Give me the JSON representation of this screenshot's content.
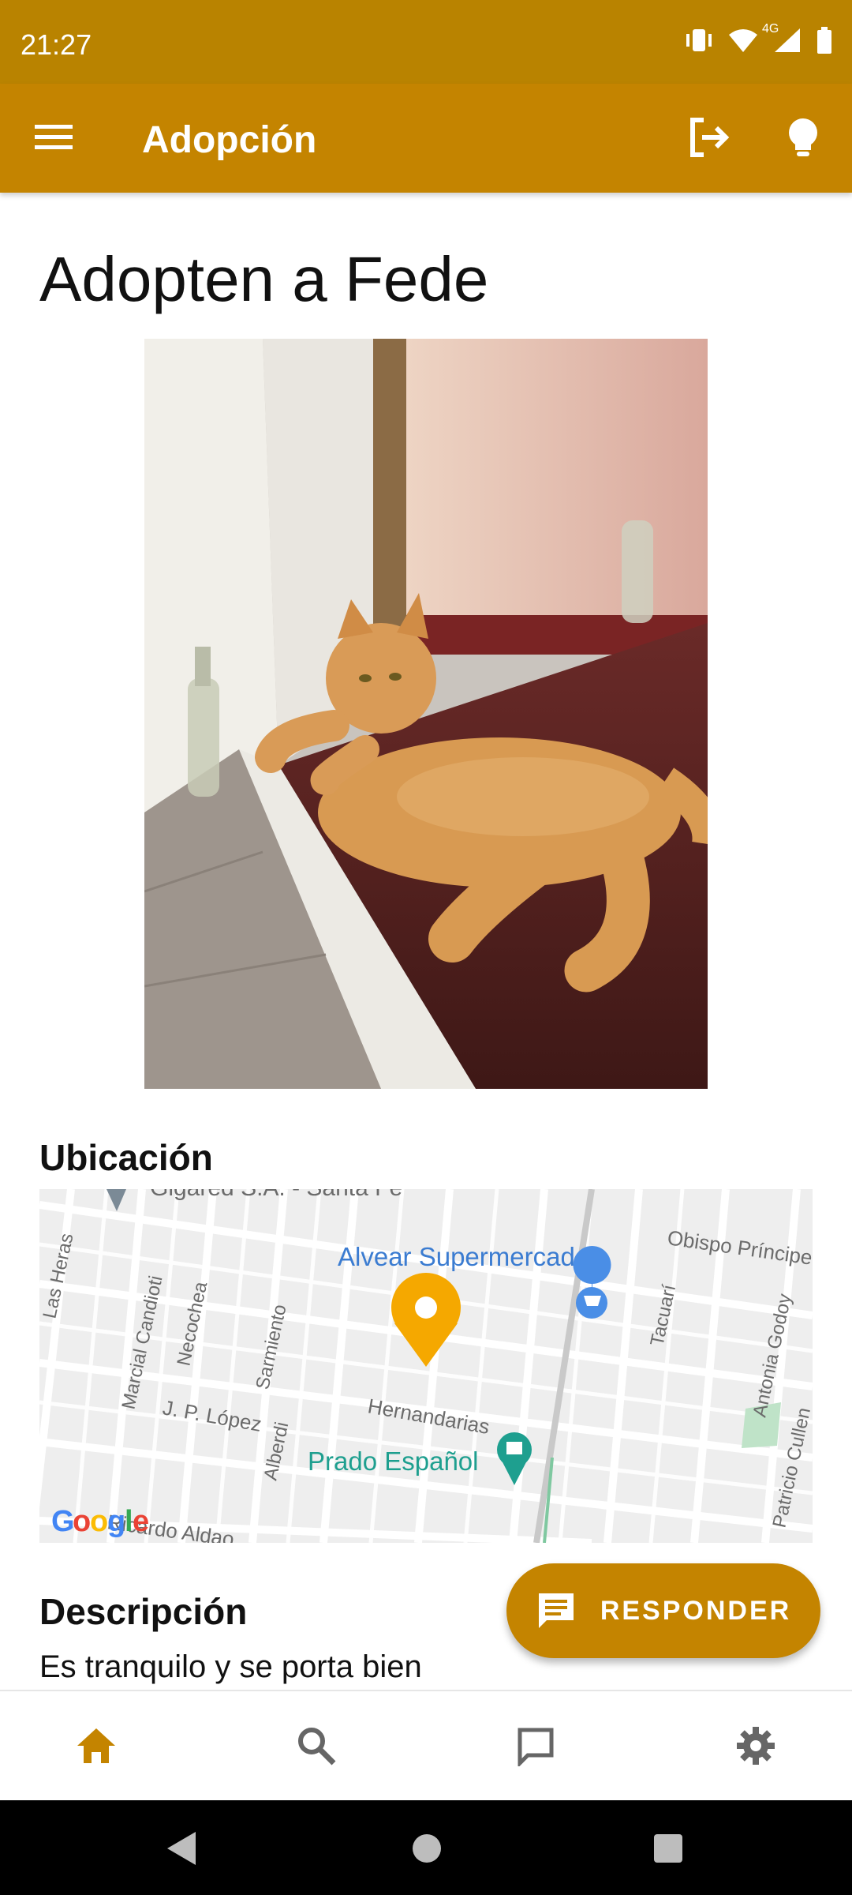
{
  "status_bar": {
    "time": "21:27",
    "network": "4G",
    "icons": [
      "vibrate-icon",
      "wifi-icon",
      "cell-signal-icon",
      "battery-icon"
    ]
  },
  "app_bar": {
    "title": "Adopción",
    "icons": [
      "menu-icon",
      "logout-icon",
      "lightbulb-icon"
    ],
    "color": "#c48400"
  },
  "post": {
    "title": "Adopten a Fede",
    "photo_icon": "cat-photo"
  },
  "location": {
    "label": "Ubicación",
    "map": {
      "streets": [
        "Las Heras",
        "Marcial Candioti",
        "Necochea",
        "Sarmiento",
        "J. P. López",
        "Alberdi",
        "Hernandarias",
        "Tacuarí",
        "Antonia Godoy",
        "Patricio Cullen",
        "Obispo Príncipe",
        "Ricardo Aldao",
        "Gigared S.A. - Santa Fe"
      ],
      "places": [
        "Alvear Supermercados",
        "Prado Español"
      ],
      "attribution": "Google"
    }
  },
  "description": {
    "label": "Descripción",
    "text": "Es tranquilo y se porta bien"
  },
  "fab": {
    "label": "RESPONDER",
    "icon": "message-icon"
  },
  "bottom_nav": {
    "items": [
      "home-icon",
      "search-icon",
      "chat-icon",
      "settings-icon"
    ],
    "active_color": "#c48400",
    "inactive_color": "#666666"
  },
  "system_nav": [
    "back-icon",
    "home-circle-icon",
    "recents-icon"
  ]
}
